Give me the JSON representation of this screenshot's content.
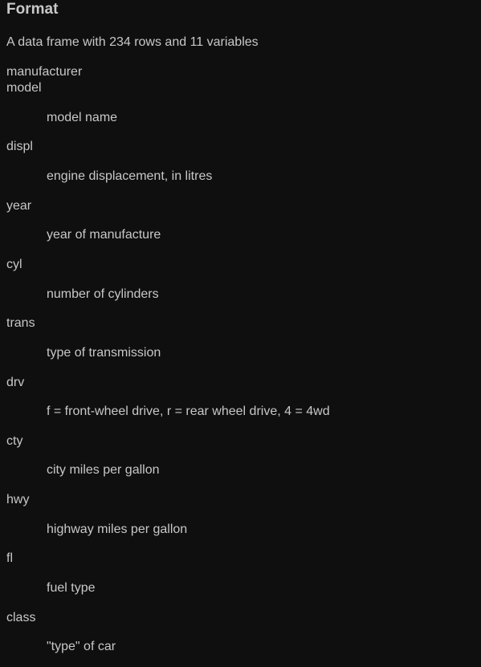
{
  "heading": "Format",
  "intro": "A data frame with 234 rows and 11 variables",
  "variables": [
    {
      "term": "manufacturer",
      "def": ""
    },
    {
      "term": "model",
      "def": "model name"
    },
    {
      "term": "displ",
      "def": "engine displacement, in litres"
    },
    {
      "term": "year",
      "def": "year of manufacture"
    },
    {
      "term": "cyl",
      "def": "number of cylinders"
    },
    {
      "term": "trans",
      "def": "type of transmission"
    },
    {
      "term": "drv",
      "def": "f = front-wheel drive, r = rear wheel drive, 4 = 4wd"
    },
    {
      "term": "cty",
      "def": "city miles per gallon"
    },
    {
      "term": "hwy",
      "def": "highway miles per gallon"
    },
    {
      "term": "fl",
      "def": "fuel type"
    },
    {
      "term": "class",
      "def": "\"type\" of car"
    }
  ]
}
